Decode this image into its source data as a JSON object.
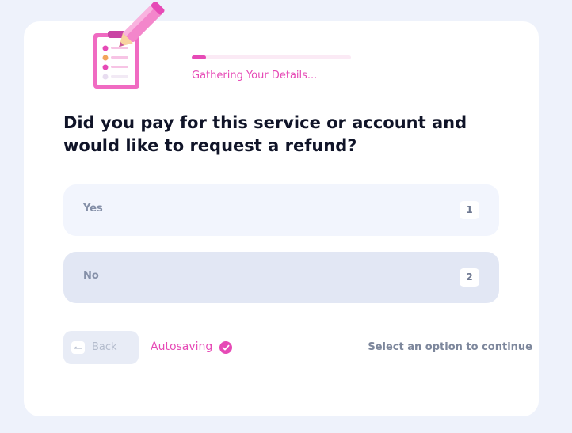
{
  "progress": {
    "label": "Gathering Your Details...",
    "fraction": 0.09
  },
  "question": "Did you pay for this service or account and would like to request a refund?",
  "options": [
    {
      "label": "Yes",
      "key": "1"
    },
    {
      "label": "No",
      "key": "2"
    }
  ],
  "footer": {
    "back_label": "Back",
    "autosave_label": "Autosaving",
    "hint": "Select an option to continue"
  },
  "icons": {
    "illustration": "clipboard-pencil-icon",
    "back": "back-arrow-icon",
    "autosave": "check-circle-icon"
  },
  "colors": {
    "accent": "#e64ab6",
    "heading": "#101428",
    "option_yes_bg": "#f2f5fd",
    "option_no_bg": "#e2e7f4"
  }
}
